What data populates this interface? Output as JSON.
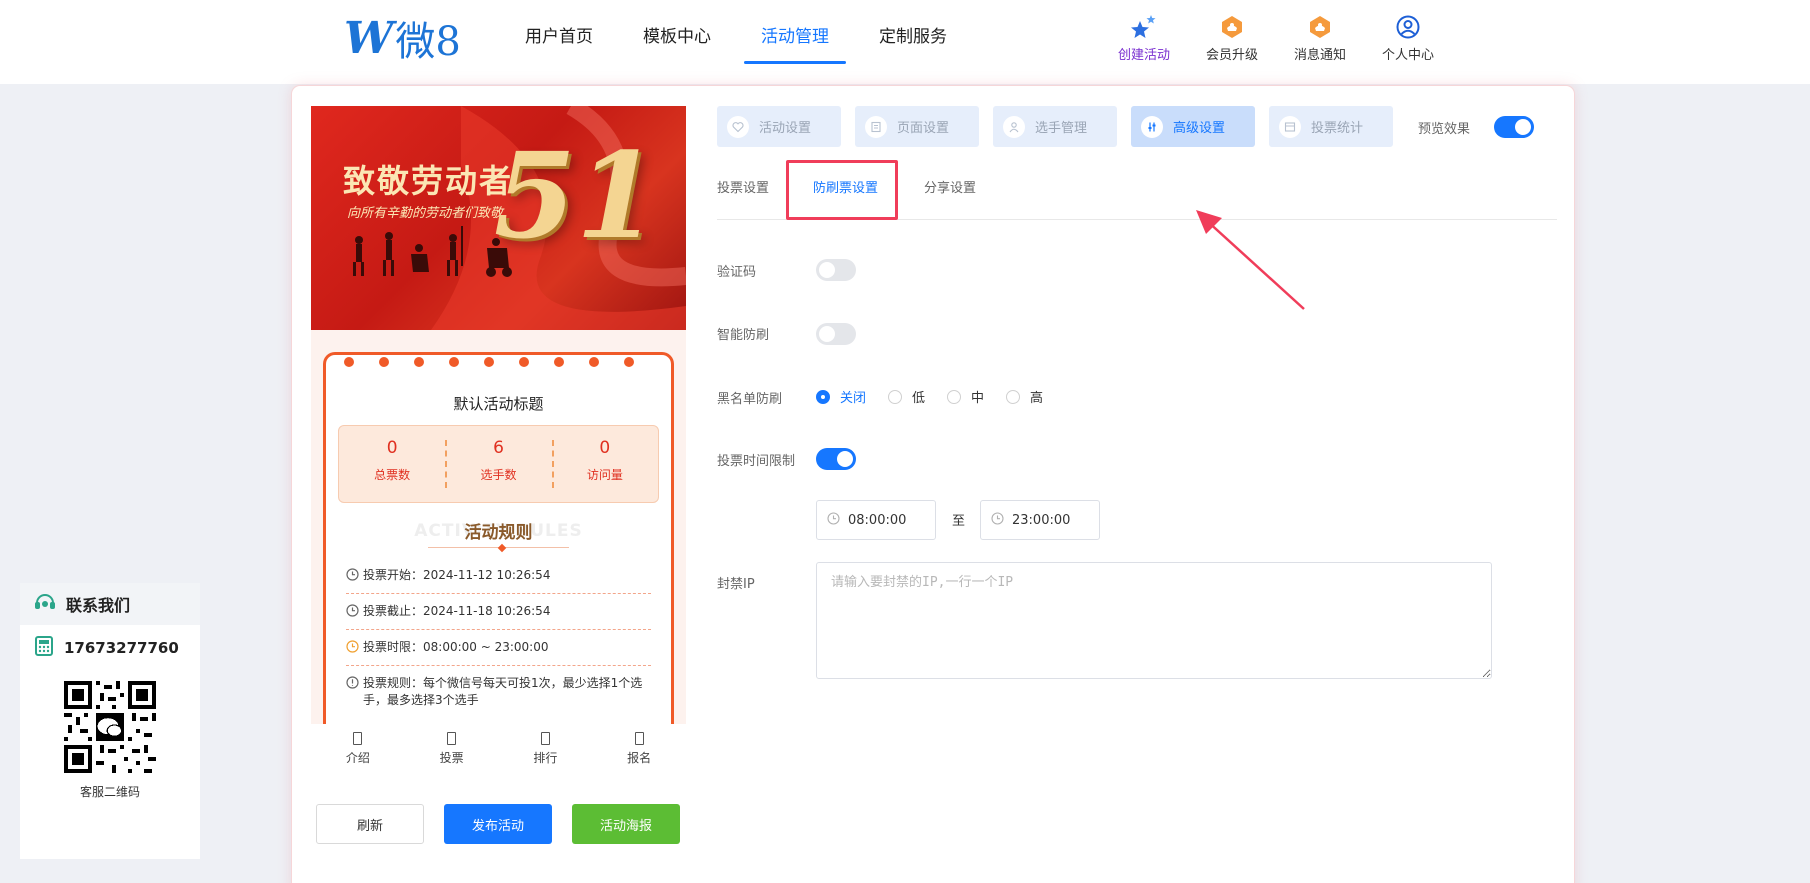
{
  "brand": {
    "logo_mark": "W",
    "logo_text": "微8"
  },
  "nav": {
    "items": [
      {
        "label": "用户首页"
      },
      {
        "label": "模板中心"
      },
      {
        "label": "活动管理"
      },
      {
        "label": "定制服务"
      }
    ],
    "active_index": 2
  },
  "quick_links": [
    {
      "label": "创建活动",
      "icon": "stars-icon"
    },
    {
      "label": "会员升级",
      "icon": "medal-icon"
    },
    {
      "label": "消息通知",
      "icon": "medal-icon"
    },
    {
      "label": "个人中心",
      "icon": "user-circle-icon"
    }
  ],
  "contact": {
    "title": "联系我们",
    "phone": "17673277760",
    "qr_label": "客服二维码"
  },
  "preview": {
    "banner": {
      "title": "致敬劳动者",
      "subtitle": "向所有辛勤的劳动者们致敬",
      "number": "51"
    },
    "activity_title": "默认活动标题",
    "stats": [
      {
        "value": "0",
        "label": "总票数"
      },
      {
        "value": "6",
        "label": "选手数"
      },
      {
        "value": "0",
        "label": "访问量"
      }
    ],
    "rules_bg": "ACTIVITY RULES",
    "rules_title": "活动规则",
    "rules": [
      {
        "text": "投票开始：2024-11-12 10:26:54"
      },
      {
        "text": "投票截止：2024-11-18 10:26:54"
      },
      {
        "text": "投票时限：08:00:00 ~ 23:00:00"
      },
      {
        "text": "投票规则：每个微信号每天可投1次，最少选择1个选手，最多选择3个选手"
      }
    ],
    "tabs": [
      {
        "label": "介绍"
      },
      {
        "label": "投票"
      },
      {
        "label": "排行"
      },
      {
        "label": "报名"
      }
    ]
  },
  "actions": {
    "refresh": "刷新",
    "publish": "发布活动",
    "poster": "活动海报"
  },
  "settings_tabs": [
    {
      "label": "活动设置"
    },
    {
      "label": "页面设置"
    },
    {
      "label": "选手管理"
    },
    {
      "label": "高级设置"
    },
    {
      "label": "投票统计"
    }
  ],
  "settings_active": 3,
  "preview_effect": {
    "label": "预览效果",
    "on": true
  },
  "sub_tabs": [
    {
      "label": "投票设置"
    },
    {
      "label": "防刷票设置"
    },
    {
      "label": "分享设置"
    }
  ],
  "sub_active": 1,
  "form": {
    "captcha": {
      "label": "验证码",
      "on": false
    },
    "smart": {
      "label": "智能防刷",
      "on": false
    },
    "blacklist": {
      "label": "黑名单防刷",
      "options": [
        "关闭",
        "低",
        "中",
        "高"
      ],
      "selected": 0
    },
    "time_limit": {
      "label": "投票时间限制",
      "on": true
    },
    "time_range": {
      "start": "08:00:00",
      "to": "至",
      "end": "23:00:00"
    },
    "ip": {
      "label": "封禁IP",
      "placeholder": "请输入要封禁的IP,一行一个IP",
      "value": ""
    }
  },
  "colors": {
    "primary": "#1677ff",
    "accent_red": "#f03d5a",
    "ticket_orange": "#f05a28",
    "green": "#5cbd34"
  }
}
